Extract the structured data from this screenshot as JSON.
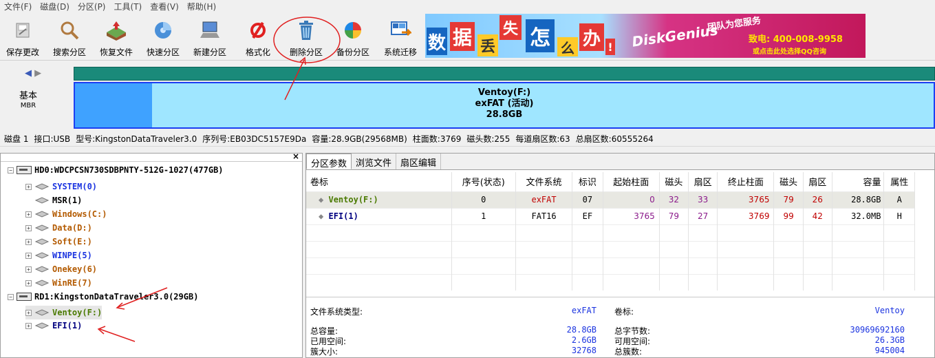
{
  "menu": [
    "文件(F)",
    "磁盘(D)",
    "分区(P)",
    "工具(T)",
    "查看(V)",
    "帮助(H)"
  ],
  "toolbar": {
    "buttons": [
      {
        "label": "保存更改",
        "icon": "save-icon"
      },
      {
        "label": "搜索分区",
        "icon": "search-icon"
      },
      {
        "label": "恢复文件",
        "icon": "recover-files-icon"
      },
      {
        "label": "快速分区",
        "icon": "quick-partition-icon"
      },
      {
        "label": "新建分区",
        "icon": "new-partition-icon"
      },
      {
        "label": "格式化",
        "icon": "format-icon"
      },
      {
        "label": "删除分区",
        "icon": "delete-partition-icon"
      },
      {
        "label": "备份分区",
        "icon": "backup-partition-icon"
      },
      {
        "label": "系统迁移",
        "icon": "system-migration-icon"
      }
    ]
  },
  "banner": {
    "chars": [
      "数",
      "据",
      "丢",
      "失",
      "怎",
      "么",
      "办",
      "!"
    ],
    "brand": "DiskGenius",
    "team": "团队为您服务",
    "phone": "致电: 400-008-9958",
    "qq": "或点击此处选择QQ咨询"
  },
  "diskmap": {
    "label": "基本",
    "sublabel": "MBR",
    "partition_name": "Ventoy(F:)",
    "partition_fs": "exFAT (活动)",
    "partition_size": "28.8GB",
    "used_fraction": 0.09
  },
  "diskinfo": {
    "disk": "磁盘 1",
    "interface": "接口:USB",
    "model": "型号:KingstonDataTraveler3.0",
    "serial": "序列号:EB03DC5157E9Da",
    "capacity": "容量:28.9GB(29568MB)",
    "cylinders": "柱面数:3769",
    "heads": "磁头数:255",
    "sectors_per_track": "每道扇区数:63",
    "total_sectors": "总扇区数:60555264"
  },
  "tree": {
    "close": "×",
    "items": [
      {
        "text": "HD0:WDCPCSN730SDBPNTY-512G-1027(477GB)",
        "level": 0,
        "type": "disk",
        "color": "c-dark"
      },
      {
        "text": "SYSTEM(0)",
        "level": 1,
        "type": "part",
        "color": "c-blue",
        "expand": true
      },
      {
        "text": "MSR(1)",
        "level": 1,
        "type": "part",
        "color": "c-dark",
        "expand": false
      },
      {
        "text": "Windows(C:)",
        "level": 1,
        "type": "part",
        "color": "c-orange",
        "expand": true
      },
      {
        "text": "Data(D:)",
        "level": 1,
        "type": "part",
        "color": "c-orange",
        "expand": true
      },
      {
        "text": "Soft(E:)",
        "level": 1,
        "type": "part",
        "color": "c-orange",
        "expand": true
      },
      {
        "text": "WINPE(5)",
        "level": 1,
        "type": "part",
        "color": "c-blue",
        "expand": true
      },
      {
        "text": "Onekey(6)",
        "level": 1,
        "type": "part",
        "color": "c-orange",
        "expand": true
      },
      {
        "text": "WinRE(7)",
        "level": 1,
        "type": "part",
        "color": "c-orange",
        "expand": true
      },
      {
        "text": "RD1:KingstonDataTraveler3.0(29GB)",
        "level": 0,
        "type": "disk",
        "color": "c-dark"
      },
      {
        "text": "Ventoy(F:)",
        "level": 1,
        "type": "part",
        "color": "c-olive",
        "expand": true,
        "selected": true
      },
      {
        "text": "EFI(1)",
        "level": 1,
        "type": "part",
        "color": "c-navy",
        "expand": true
      }
    ]
  },
  "tabs": [
    "分区参数",
    "浏览文件",
    "扇区编辑"
  ],
  "table": {
    "headers": [
      "卷标",
      "序号(状态)",
      "文件系统",
      "标识",
      "起始柱面",
      "磁头",
      "扇区",
      "终止柱面",
      "磁头",
      "扇区",
      "容量",
      "属性"
    ],
    "rows": [
      [
        "Ventoy(F:)",
        "0",
        "exFAT",
        "07",
        "0",
        "32",
        "33",
        "3765",
        "79",
        "26",
        "28.8GB",
        "A"
      ],
      [
        "EFI(1)",
        "1",
        "FAT16",
        "EF",
        "3765",
        "79",
        "27",
        "3769",
        "99",
        "42",
        "32.0MB",
        "H"
      ]
    ]
  },
  "fsinfo": {
    "fs_type_label": "文件系统类型:",
    "fs_type_value": "exFAT",
    "volume_label": "卷标:",
    "volume_value": "Ventoy",
    "total_label": "总容量:",
    "total_value": "28.8GB",
    "total_bytes_label": "总字节数:",
    "total_bytes_value": "30969692160",
    "used_label": "已用空间:",
    "used_value": "2.6GB",
    "free_label": "可用空间:",
    "free_value": "26.3GB",
    "cluster_label": "簇大小:",
    "cluster_value": "32768",
    "clusters_label": "总簇数:",
    "clusters_value": "945004"
  },
  "colors": {
    "annotation": "#e02020",
    "partition_border": "#1c3ff2",
    "partition_fill": "#9fe6ff"
  }
}
